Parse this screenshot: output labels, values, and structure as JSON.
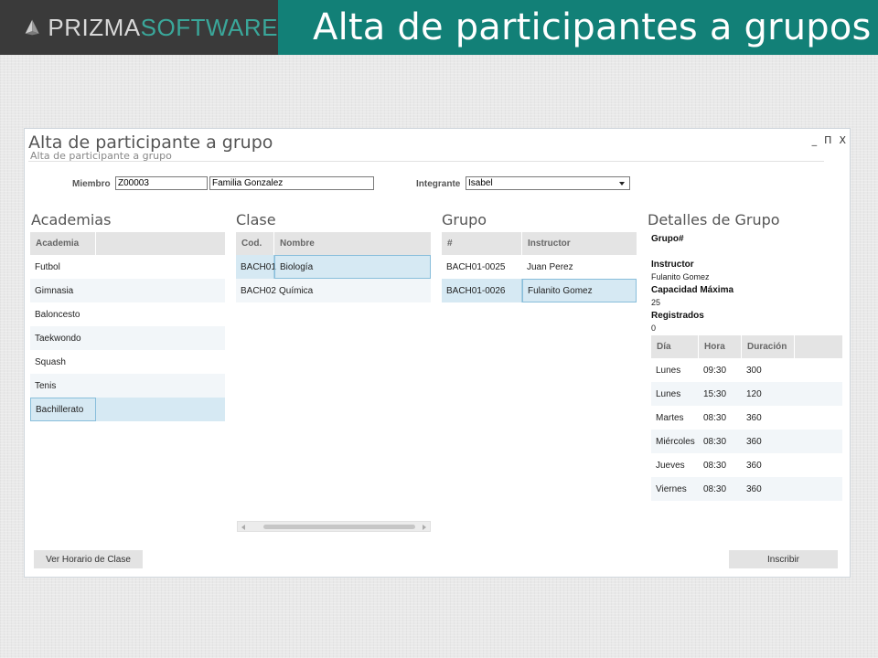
{
  "banner": {
    "logo_prizma": "PRIZMA",
    "logo_software": "SOFTWARE",
    "slide_title": "Alta de participantes a grupos"
  },
  "window": {
    "title": "Alta de participante a grupo",
    "subtitle": "Alta de participante a grupo",
    "controls": {
      "minimize": "_",
      "maximize": "Π",
      "close": "X"
    }
  },
  "form": {
    "miembro_label": "Miembro",
    "miembro_id": "Z00003",
    "miembro_name": "Familia Gonzalez",
    "integrante_label": "Integrante",
    "integrante_value": "Isabel"
  },
  "academias": {
    "heading": "Academias",
    "column": "Academia",
    "rows": [
      "Futbol",
      "Gimnasia",
      "Baloncesto",
      "Taekwondo",
      "Squash",
      "Tenis",
      "Bachillerato"
    ]
  },
  "clase": {
    "heading": "Clase",
    "columns": [
      "Cod.",
      "Nombre"
    ],
    "rows": [
      {
        "cod": "BACH01",
        "nombre": "Biología"
      },
      {
        "cod": "BACH02",
        "nombre": "Química"
      }
    ]
  },
  "grupo": {
    "heading": "Grupo",
    "columns": [
      "#",
      "Instructor"
    ],
    "rows": [
      {
        "num": "BACH01-0025",
        "instructor": "Juan Perez"
      },
      {
        "num": "BACH01-0026",
        "instructor": "Fulanito Gomez"
      }
    ]
  },
  "detalles": {
    "heading": "Detalles de Grupo",
    "grupo_label": "Grupo#",
    "instructor_label": "Instructor",
    "instructor_value": "Fulanito Gomez",
    "capacidad_label": "Capacidad Máxima",
    "capacidad_value": "25",
    "registrados_label": "Registrados",
    "registrados_value": "0",
    "columns": [
      "Día",
      "Hora",
      "Duración"
    ],
    "rows": [
      {
        "dia": "Lunes",
        "hora": "09:30",
        "duracion": "300"
      },
      {
        "dia": "Lunes",
        "hora": "15:30",
        "duracion": "120"
      },
      {
        "dia": "Martes",
        "hora": "08:30",
        "duracion": "360"
      },
      {
        "dia": "Miércoles",
        "hora": "08:30",
        "duracion": "360"
      },
      {
        "dia": "Jueves",
        "hora": "08:30",
        "duracion": "360"
      },
      {
        "dia": "Viernes",
        "hora": "08:30",
        "duracion": "360"
      }
    ]
  },
  "buttons": {
    "ver_horario": "Ver Horario de Clase",
    "inscribir": "Inscribir"
  },
  "colors": {
    "banner_teal": "#128077",
    "logo_dark": "#3a3a3a",
    "selected_row": "#d6e9f3"
  }
}
